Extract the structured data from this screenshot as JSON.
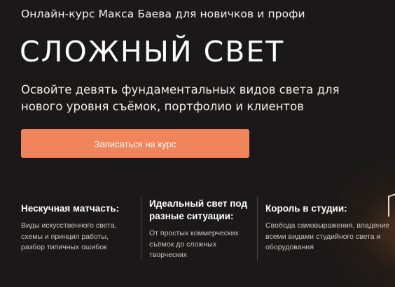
{
  "hero": {
    "eyebrow": "Онлайн-курс Макса Баева для новичков и профи",
    "title": "СЛОЖНЫЙ СВЕТ",
    "subtitle": "Освойте девять фундаментальных видов света для нового уровня съёмок, портфолио и клиентов",
    "cta_label": "Записаться на курс",
    "accent_color": "#f0845a",
    "background_color": "#1a1818"
  },
  "features": [
    {
      "title": "Нескучная матчасть:",
      "text": "Виды искусственного света, схемы и принцип работы, разбор типичных ошибок"
    },
    {
      "title": "Идеальный свет под разные ситуации:",
      "text": "От простых коммерческих съёмок до сложных творческих"
    },
    {
      "title": "Король в студии:",
      "text": "Свобода самовыражения, владение всеми видами студийного света и оборудования"
    }
  ]
}
